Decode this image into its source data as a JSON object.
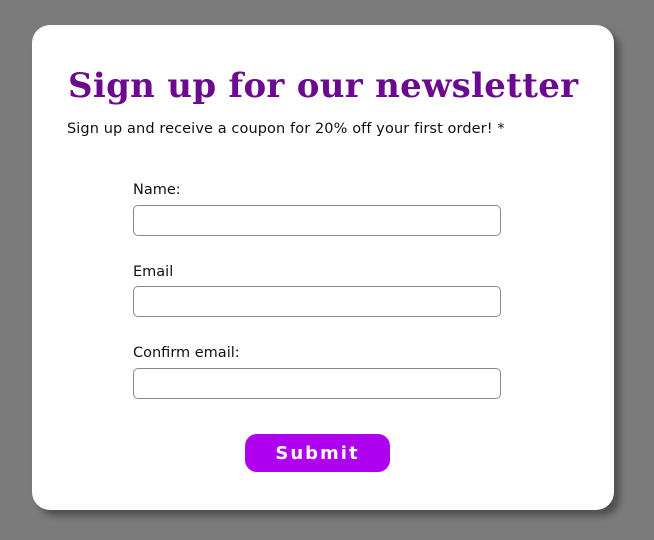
{
  "form": {
    "title": "Sign up for our newsletter",
    "subtitle": "Sign up and receive a coupon for 20% off your first order! *",
    "fields": [
      {
        "label": "Name:",
        "value": "",
        "placeholder": ""
      },
      {
        "label": "Email",
        "value": "",
        "placeholder": ""
      },
      {
        "label": "Confirm email:",
        "value": "",
        "placeholder": ""
      }
    ],
    "submit_label": "Submit"
  },
  "colors": {
    "background": "#7b7b7b",
    "card": "#ffffff",
    "title": "#6b0a8f",
    "button": "#b000f0",
    "button_text": "#ffffff"
  }
}
